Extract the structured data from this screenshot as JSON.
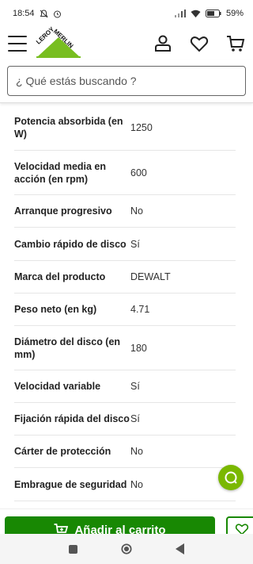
{
  "status_bar": {
    "time": "18:54",
    "battery": "59%"
  },
  "header": {
    "logo_text_line1": "LEROY",
    "logo_text_line2": "MERLIN"
  },
  "search": {
    "placeholder": "¿ Qué estás buscando ?"
  },
  "specs": [
    {
      "label": "Potencia absorbida (en W)",
      "value": "1250"
    },
    {
      "label": "Velocidad media en acción (en rpm)",
      "value": "600"
    },
    {
      "label": "Arranque progresivo",
      "value": "No"
    },
    {
      "label": "Cambio rápido de disco",
      "value": "Sí"
    },
    {
      "label": "Marca del producto",
      "value": "DEWALT"
    },
    {
      "label": "Peso neto (en kg)",
      "value": "4.71"
    },
    {
      "label": "Diámetro del disco (en mm)",
      "value": "180"
    },
    {
      "label": "Velocidad variable",
      "value": "Sí"
    },
    {
      "label": "Fijación rápida del disco",
      "value": "Sí"
    },
    {
      "label": "Cárter de protección",
      "value": "No"
    },
    {
      "label": "Embrague de seguridad",
      "value": "No"
    }
  ],
  "cart": {
    "add_label": "Añadir al carrito"
  },
  "colors": {
    "brand_green": "#188803",
    "fab_green": "#7ab800",
    "logo_green": "#78be20"
  },
  "icons": {
    "account": "user-icon",
    "wishlist": "heart-icon",
    "cart": "cart-icon",
    "chat": "chat-icon"
  }
}
